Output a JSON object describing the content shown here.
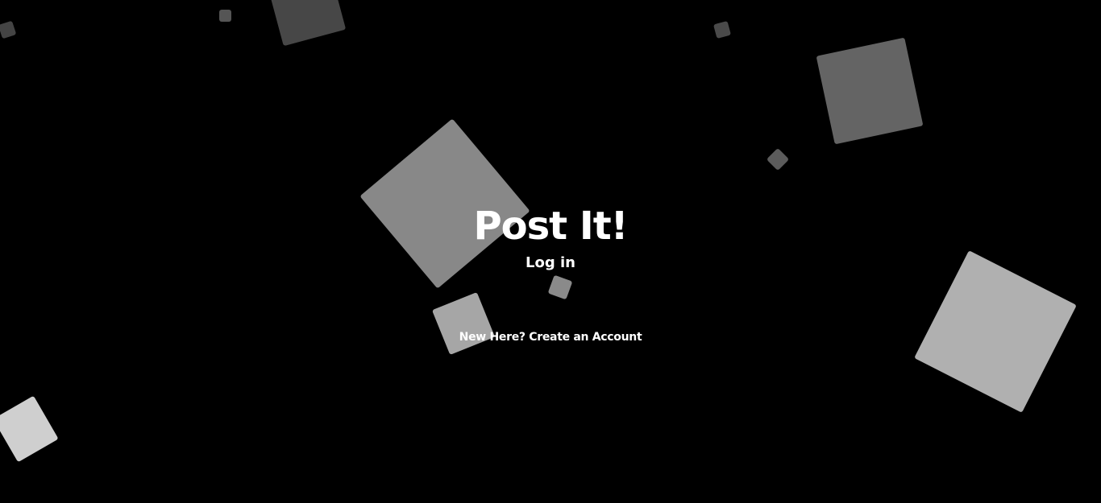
{
  "app": {
    "title": "Post It!"
  },
  "actions": {
    "login_label": "Log in",
    "signup_label": "New Here? Create an Account"
  },
  "theme": {
    "background": "#000000",
    "text": "#ffffff"
  }
}
